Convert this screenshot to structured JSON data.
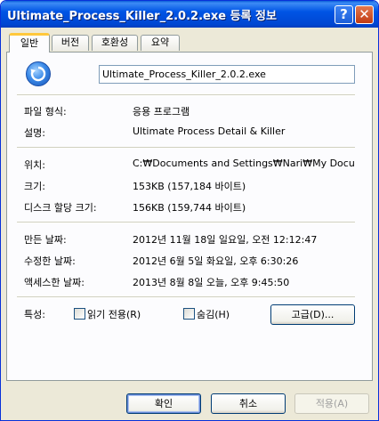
{
  "window": {
    "title": "Ultimate_Process_Killer_2.0.2.exe 등록 정보",
    "help_glyph": "?",
    "close_glyph": "✕"
  },
  "tabs": [
    {
      "label": "일반"
    },
    {
      "label": "버전"
    },
    {
      "label": "호환성"
    },
    {
      "label": "요약"
    }
  ],
  "general": {
    "app_icon": "refresh-arrows-icon",
    "file_name": "Ultimate_Process_Killer_2.0.2.exe",
    "file_type_label": "파일 형식:",
    "file_type_value": "응용 프로그램",
    "description_label": "설명:",
    "description_value": "Ultimate Process Detail & Killer",
    "location_label": "위치:",
    "location_value": "C:₩Documents and Settings₩Nari₩My Docu",
    "size_label": "크기:",
    "size_value": "153KB (157,184 바이트)",
    "size_on_disk_label": "디스크 할당 크기:",
    "size_on_disk_value": "156KB (159,744 바이트)",
    "created_label": "만든 날짜:",
    "created_value": "2012년 11월 18일 일요일, 오전 12:12:47",
    "modified_label": "수정한 날짜:",
    "modified_value": "2012년 6월 5일 화요일, 오후 6:30:26",
    "accessed_label": "액세스한 날짜:",
    "accessed_value": "2013년 8월 8일 오늘, 오후 9:45:50",
    "attributes_label": "특성:",
    "readonly_label": "읽기 전용(R)",
    "hidden_label": "숨김(H)",
    "advanced_label": "고급(D)..."
  },
  "footer": {
    "ok_label": "확인",
    "cancel_label": "취소",
    "apply_label": "적용(A)"
  },
  "colors": {
    "titlebar": "#0055e5",
    "window_bg": "#ece9d8",
    "active_tab_accent": "#ffc83c"
  }
}
